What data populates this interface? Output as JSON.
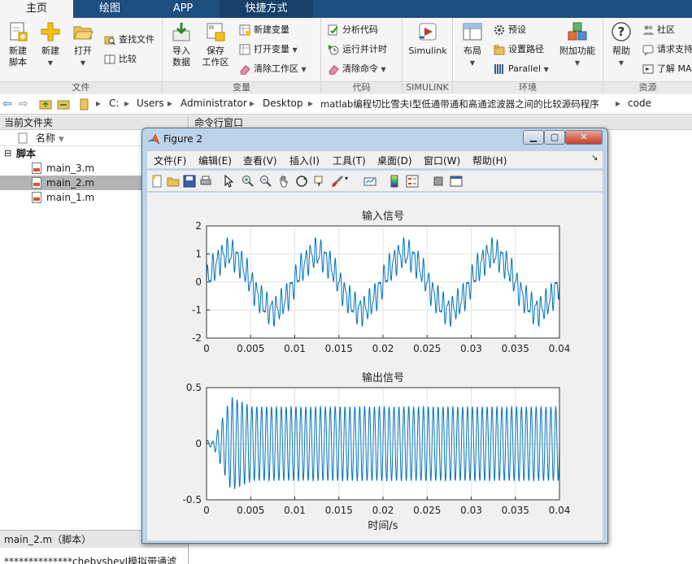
{
  "ribbon_tabs": [
    "主页",
    "绘图",
    "APP",
    "快捷方式"
  ],
  "ribbon": {
    "file_group": "文件",
    "new_script": "新建\n脚本",
    "new": "新建",
    "open": "打开",
    "find_files": "查找文件",
    "compare": "比较",
    "variable_group": "变量",
    "import_data": "导入\n数据",
    "save_workspace": "保存\n工作区",
    "new_variable": "新建变量",
    "open_variable": "打开变量",
    "clear_workspace": "清除工作区",
    "code_group": "代码",
    "analyze_code": "分析代码",
    "run_and_time": "运行并计时",
    "clear_commands": "清除命令",
    "simulink_group": "SIMULINK",
    "simulink": "Simulink",
    "env_group": "环境",
    "layout": "布局",
    "preferences": "预设",
    "set_path": "设置路径",
    "parallel": "Parallel",
    "addons": "附加功能",
    "resources_group": "资源",
    "help": "帮助",
    "community": "社区",
    "request_support": "请求支持",
    "learn_matlab": "了解 MA"
  },
  "address": {
    "path": [
      "C:",
      "Users",
      "Administrator",
      "Desktop",
      "matlab编程切比雪夫I型低通带通和高通滤波器之间的比较源码程序",
      "code"
    ]
  },
  "current_folder": {
    "title": "当前文件夹",
    "column_name": "名称",
    "group": "脚本",
    "files": [
      "main_3.m",
      "main_2.m",
      "main_1.m"
    ],
    "selected": "main_2.m",
    "detail_title": "main_2.m（脚本）",
    "detail_text": "**************chebyshevI模拟带通滤"
  },
  "command_window": {
    "title": "命令行窗口"
  },
  "figure": {
    "title": "Figure 2",
    "menus": [
      "文件(F)",
      "编辑(E)",
      "查看(V)",
      "插入(I)",
      "工具(T)",
      "桌面(D)",
      "窗口(W)",
      "帮助(H)"
    ],
    "overflow": "↘"
  },
  "chart_data": [
    {
      "type": "line",
      "title": "输入信号",
      "xlabel": "",
      "ylabel": "",
      "xlim": [
        0,
        0.04
      ],
      "ylim": [
        -2,
        2
      ],
      "xticks": [
        "0",
        "0.005",
        "0.01",
        "0.015",
        "0.02",
        "0.025",
        "0.03",
        "0.035",
        "0.04"
      ],
      "yticks": [
        "2",
        "1",
        "0",
        "-1",
        "-2"
      ],
      "grid": true,
      "color": "#0072bd",
      "components": [
        {
          "type": "sine",
          "amplitude": 1.0,
          "frequency_hz": 100
        },
        {
          "type": "sine",
          "amplitude": 0.4,
          "frequency_hz": 1800
        },
        {
          "type": "sine",
          "amplitude": 0.2,
          "frequency_hz": 3100
        }
      ]
    },
    {
      "type": "line",
      "title": "输出信号",
      "xlabel": "时间/s",
      "ylabel": "",
      "xlim": [
        0,
        0.04
      ],
      "ylim": [
        -0.5,
        0.5
      ],
      "xticks": [
        "0",
        "0.005",
        "0.01",
        "0.015",
        "0.02",
        "0.025",
        "0.03",
        "0.035",
        "0.04"
      ],
      "yticks": [
        "0.5",
        "0",
        "-0.5"
      ],
      "grid": true,
      "color": "#0072bd",
      "components": [
        {
          "type": "sine",
          "amplitude": 0.33,
          "frequency_hz": 1800,
          "settling_time_s": 0.004,
          "overshoot_peak": 0.42
        }
      ]
    }
  ]
}
